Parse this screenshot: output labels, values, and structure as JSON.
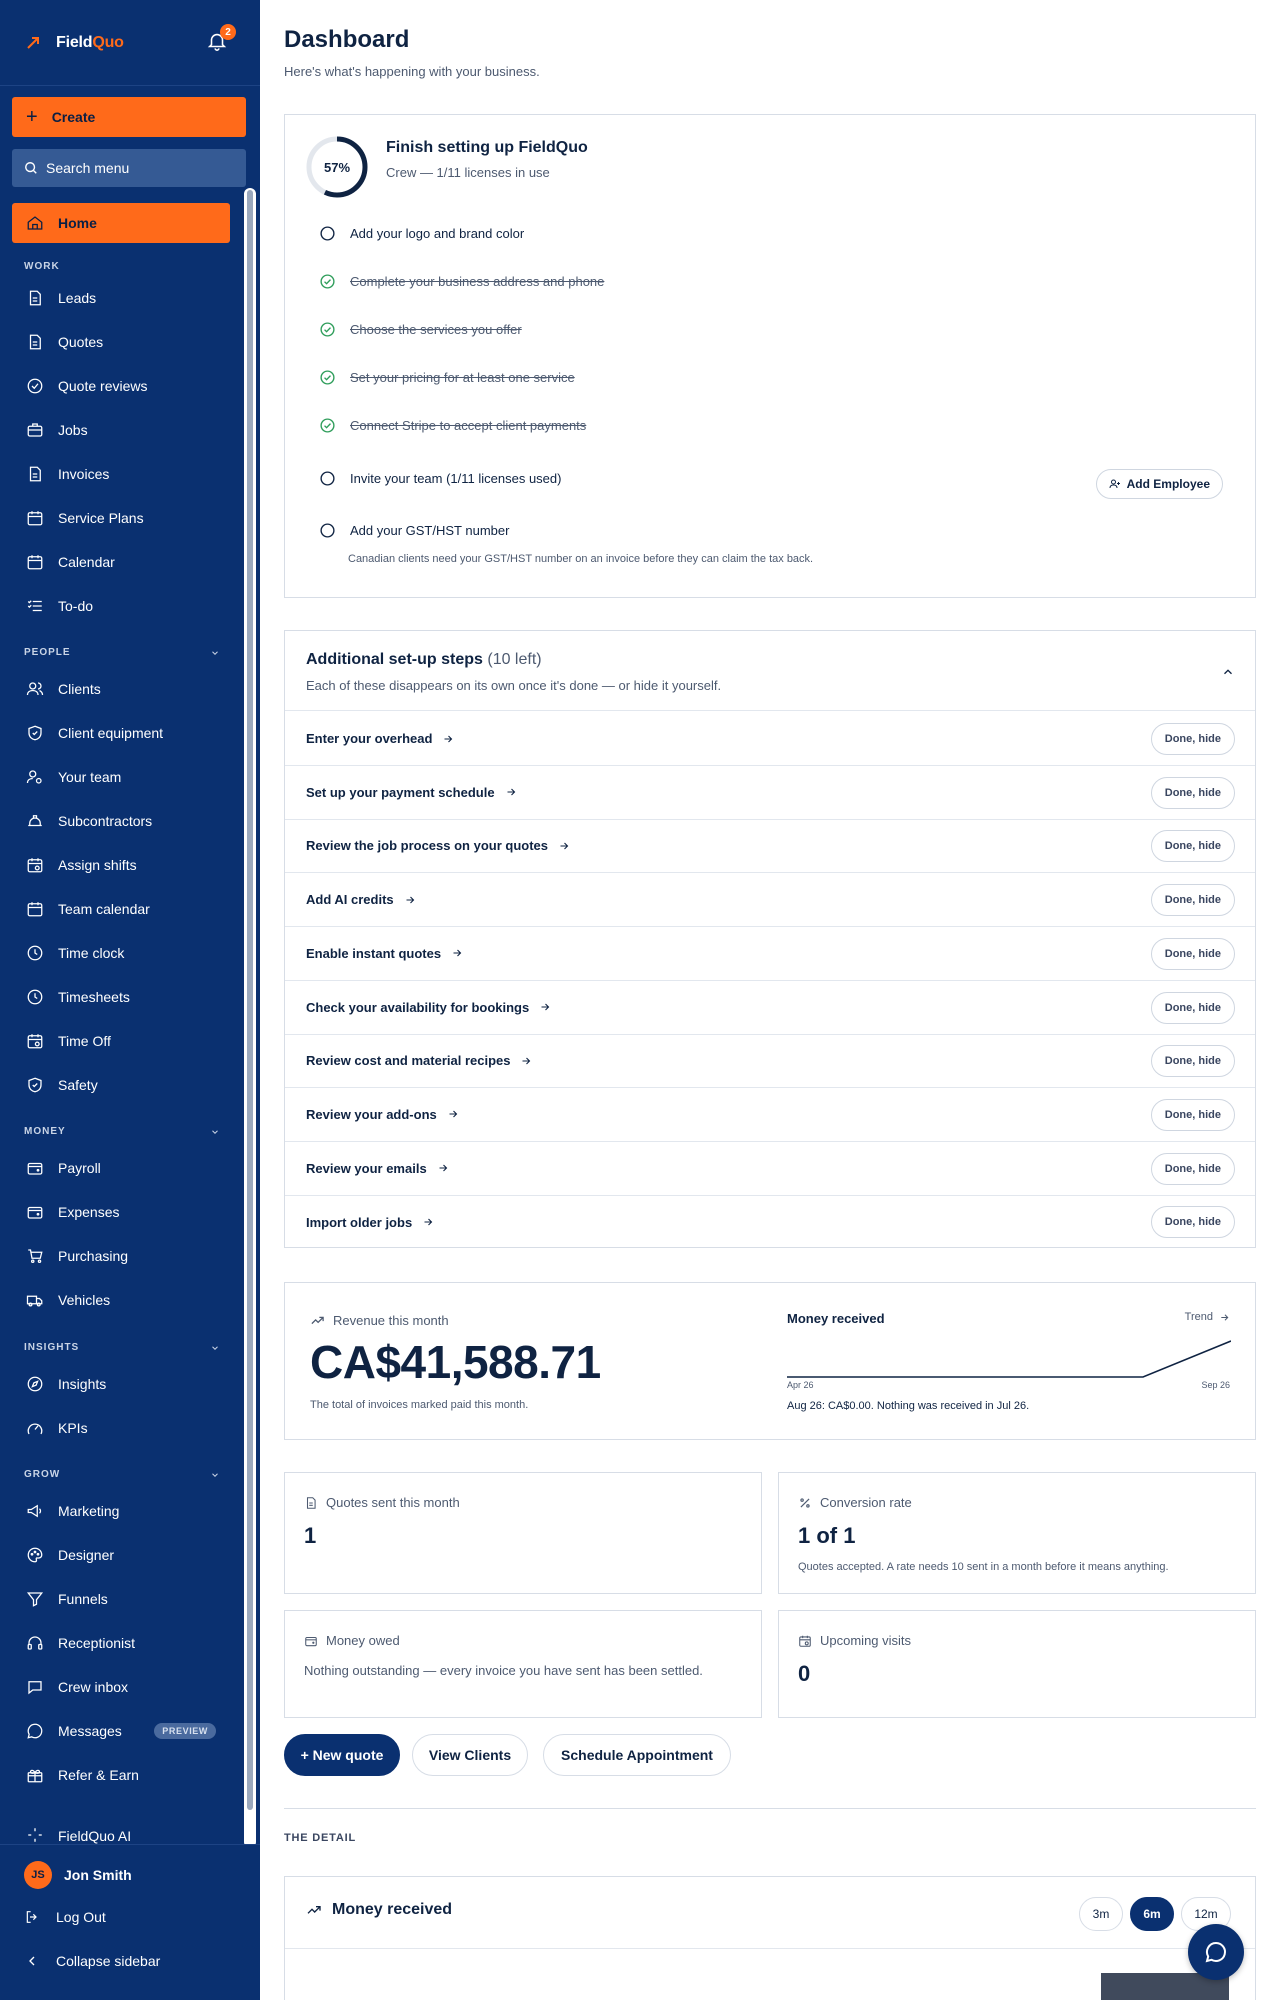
{
  "brand": {
    "name_part1": "Field",
    "name_part2": "Quo",
    "notification_count": "2"
  },
  "sidebar": {
    "create_label": "Create",
    "search_placeholder": "Search menu",
    "home_label": "Home",
    "sections": {
      "work": "WORK",
      "people": "PEOPLE",
      "money": "MONEY",
      "insights": "INSIGHTS",
      "grow": "GROW"
    },
    "work_items": [
      "Leads",
      "Quotes",
      "Quote reviews",
      "Jobs",
      "Invoices",
      "Service Plans",
      "Calendar",
      "To-do"
    ],
    "people_items": [
      "Clients",
      "Client equipment",
      "Your team",
      "Subcontractors",
      "Assign shifts",
      "Team calendar",
      "Time clock",
      "Timesheets",
      "Time Off",
      "Safety"
    ],
    "money_items": [
      "Payroll",
      "Expenses",
      "Purchasing",
      "Vehicles"
    ],
    "insights_items": [
      "Insights",
      "KPIs"
    ],
    "grow_items": [
      "Marketing",
      "Designer",
      "Funnels",
      "Receptionist",
      "Crew inbox",
      "Messages",
      "Refer & Earn"
    ],
    "preview_badge": "PREVIEW",
    "ai_item": "FieldQuo AI",
    "user_initials": "JS",
    "user_name": "Jon Smith",
    "logout": "Log Out",
    "collapse": "Collapse sidebar"
  },
  "page": {
    "title": "Dashboard",
    "subtitle": "Here's what's happening with your business."
  },
  "setup": {
    "progress": 0.57,
    "progress_label": "57%",
    "title": "Finish setting up FieldQuo",
    "subtitle": "Crew — 1/11 licenses in use",
    "tasks": [
      {
        "label": "Add your logo and brand color",
        "done": false
      },
      {
        "label": "Complete your business address and phone",
        "done": true
      },
      {
        "label": "Choose the services you offer",
        "done": true
      },
      {
        "label": "Set your pricing for at least one service",
        "done": true
      },
      {
        "label": "Connect Stripe to accept client payments",
        "done": true
      },
      {
        "label": "Invite your team (1/11 licenses used)",
        "done": false
      },
      {
        "label": "Add your GST/HST number",
        "done": false
      }
    ],
    "gst_note": "Canadian clients need your GST/HST number on an invoice before they can claim the tax back.",
    "add_employee": "Add Employee"
  },
  "steps": {
    "title": "Additional set-up steps",
    "count": "(10 left)",
    "subtitle": "Each of these disappears on its own once it's done — or hide it yourself.",
    "done_label": "Done, hide",
    "items": [
      "Enter your overhead",
      "Set up your payment schedule",
      "Review the job process on your quotes",
      "Add AI credits",
      "Enable instant quotes",
      "Check your availability for bookings",
      "Review cost and material recipes",
      "Review your add-ons",
      "Review your emails",
      "Import older jobs"
    ]
  },
  "revenue": {
    "label": "Revenue this month",
    "amount": "CA$41,588.71",
    "note": "The total of invoices marked paid this month.",
    "money_received_title": "Money received",
    "trend": "Trend",
    "axis_start": "Apr 26",
    "axis_end": "Sep 26",
    "summary": "Aug 26: CA$0.00. Nothing was received in Jul 26."
  },
  "stats": {
    "quotes_label": "Quotes sent this month",
    "quotes_value": "1",
    "conversion_label": "Conversion rate",
    "conversion_value": "1 of 1",
    "conversion_note": "Quotes accepted. A rate needs 10 sent in a month before it means anything.",
    "owed_label": "Money owed",
    "owed_text": "Nothing outstanding — every invoice you have sent has been settled.",
    "visits_label": "Upcoming visits",
    "visits_value": "0"
  },
  "actions": {
    "new_quote": "+ New quote",
    "view_clients": "View Clients",
    "schedule": "Schedule Appointment"
  },
  "detail": {
    "label": "THE DETAIL",
    "money_received": "Money received",
    "ranges": [
      "3m",
      "6m",
      "12m"
    ],
    "active_range": "6m"
  },
  "colors": {
    "sidebar_bg": "#0a3070",
    "accent": "#ff6a1a",
    "done_green": "#2e9d5a",
    "text_dark": "#0f2342"
  }
}
